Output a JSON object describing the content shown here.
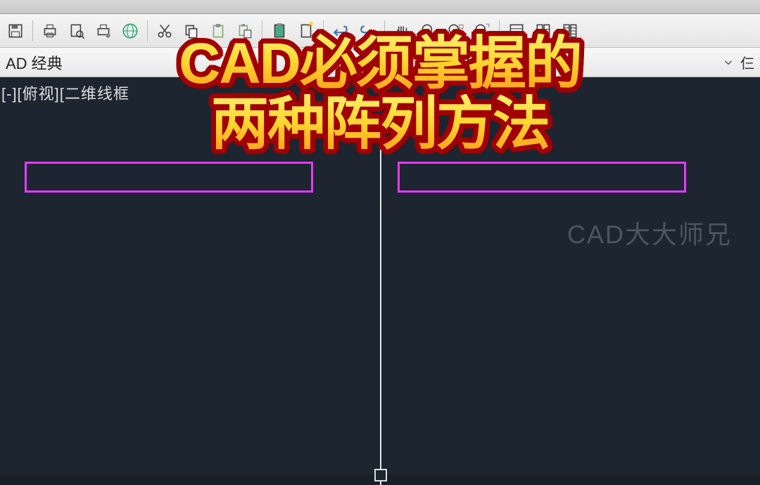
{
  "workspace": {
    "label": "AD 经典",
    "right_label": "仨"
  },
  "viewport": {
    "label": "[-][俯视][二维线框"
  },
  "title": {
    "line1": "CAD必须掌握的",
    "line2": "两种阵列方法"
  },
  "watermark": "CAD大大师兄",
  "toolbar_icons": [
    "save-icon",
    "print-icon",
    "print-preview-icon",
    "page-setup-icon",
    "globe-icon",
    "cut-icon",
    "copy-icon",
    "paste-icon",
    "paste-special-icon",
    "clipboard-icon",
    "format-painter-icon",
    "undo-icon",
    "redo-icon",
    "pan-icon",
    "zoom-1-icon",
    "zoom-2-icon",
    "zoom-3-icon",
    "properties-icon",
    "grid-1-icon",
    "grid-2-icon"
  ]
}
